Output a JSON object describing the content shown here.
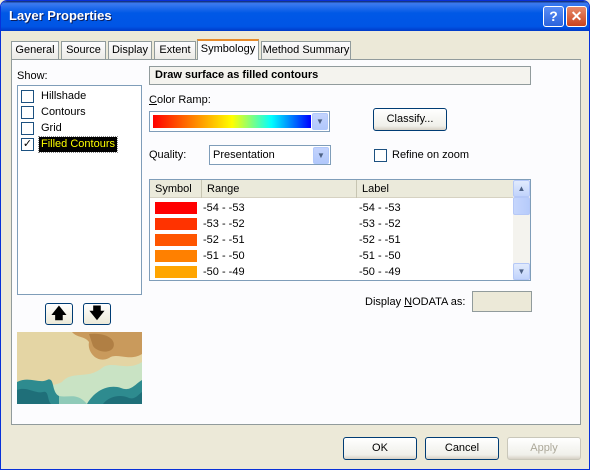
{
  "window": {
    "title": "Layer Properties",
    "help_glyph": "?",
    "close_glyph": "✕"
  },
  "tabs": [
    {
      "label": "General"
    },
    {
      "label": "Source"
    },
    {
      "label": "Display"
    },
    {
      "label": "Extent"
    },
    {
      "label": "Symbology"
    },
    {
      "label": "Method Summary"
    }
  ],
  "active_tab": "Symbology",
  "show": {
    "label": "Show:",
    "items": [
      {
        "label": "Hillshade",
        "checked": false,
        "mark": ""
      },
      {
        "label": "Contours",
        "checked": false,
        "mark": ""
      },
      {
        "label": "Grid",
        "checked": false,
        "mark": ""
      },
      {
        "label": "Filled Contours",
        "checked": true,
        "mark": "✓"
      }
    ],
    "up_glyph": "🡅",
    "down_glyph": "🡇"
  },
  "symbology": {
    "header": "Draw surface as filled contours",
    "color_ramp_label": "Color Ramp:",
    "color_ramp_colors": [
      "#ff0000",
      "#ff8000",
      "#ffff00",
      "#00ffff",
      "#0000ff"
    ],
    "classify_button": "Classify...",
    "quality_label": "Quality:",
    "quality_value": "Presentation",
    "refine_label": "Refine on zoom",
    "refine_checked": false,
    "dropdown_glyph": "▼",
    "table": {
      "headers": [
        "Symbol",
        "Range",
        "Label"
      ],
      "rows": [
        {
          "color": "#ff0000",
          "range": "-54 - -53",
          "label": "-54 - -53"
        },
        {
          "color": "#ff3300",
          "range": "-53 - -52",
          "label": "-53 - -52"
        },
        {
          "color": "#ff5500",
          "range": "-52 - -51",
          "label": "-52 - -51"
        },
        {
          "color": "#ff8000",
          "range": "-51 - -50",
          "label": "-51 - -50"
        },
        {
          "color": "#ffa500",
          "range": "-50 - -49",
          "label": "-50 - -49"
        }
      ],
      "scroll_up_glyph": "▲",
      "scroll_down_glyph": "▼"
    },
    "nodata_label": "Display NODATA as:"
  },
  "footer": {
    "ok": "OK",
    "cancel": "Cancel",
    "apply": "Apply"
  }
}
